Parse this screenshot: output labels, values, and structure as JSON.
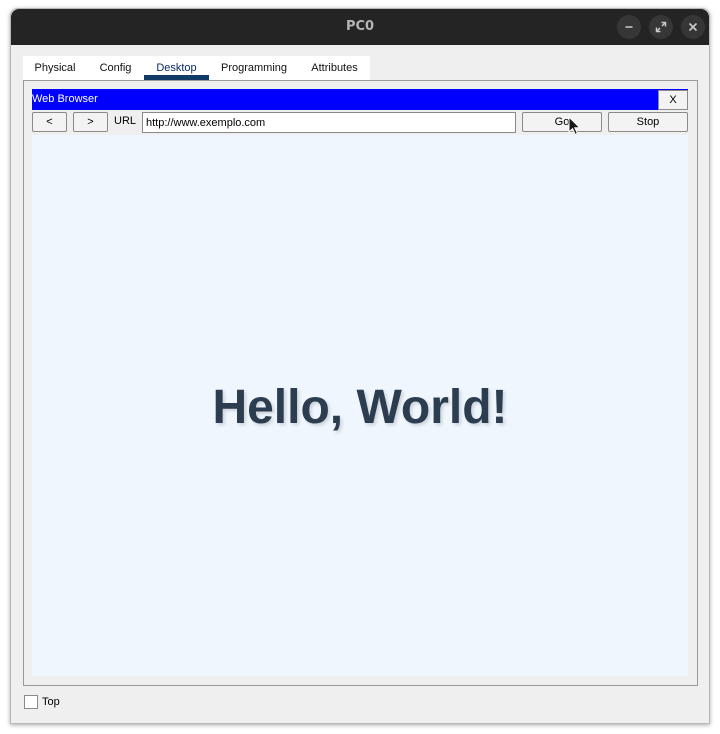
{
  "window": {
    "title": "PC0"
  },
  "tabs": [
    {
      "label": "Physical"
    },
    {
      "label": "Config"
    },
    {
      "label": "Desktop"
    },
    {
      "label": "Programming"
    },
    {
      "label": "Attributes"
    }
  ],
  "active_tab": "Desktop",
  "browser": {
    "title": "Web Browser",
    "close_label": "X",
    "back_label": "<",
    "forward_label": ">",
    "url_label": "URL",
    "url_value": "http://www.exemplo.com",
    "go_label": "Go",
    "stop_label": "Stop",
    "page_heading": "Hello, World!"
  },
  "footer": {
    "top_label": "Top",
    "top_checked": false
  },
  "colors": {
    "browser_titlebar": "#0000ff",
    "page_background": "#eff6fd",
    "heading_color": "#2d3d50",
    "active_tab_underline": "#123a66"
  },
  "icons": [
    "minimize-icon",
    "maximize-icon",
    "close-icon",
    "mouse-pointer-icon"
  ]
}
